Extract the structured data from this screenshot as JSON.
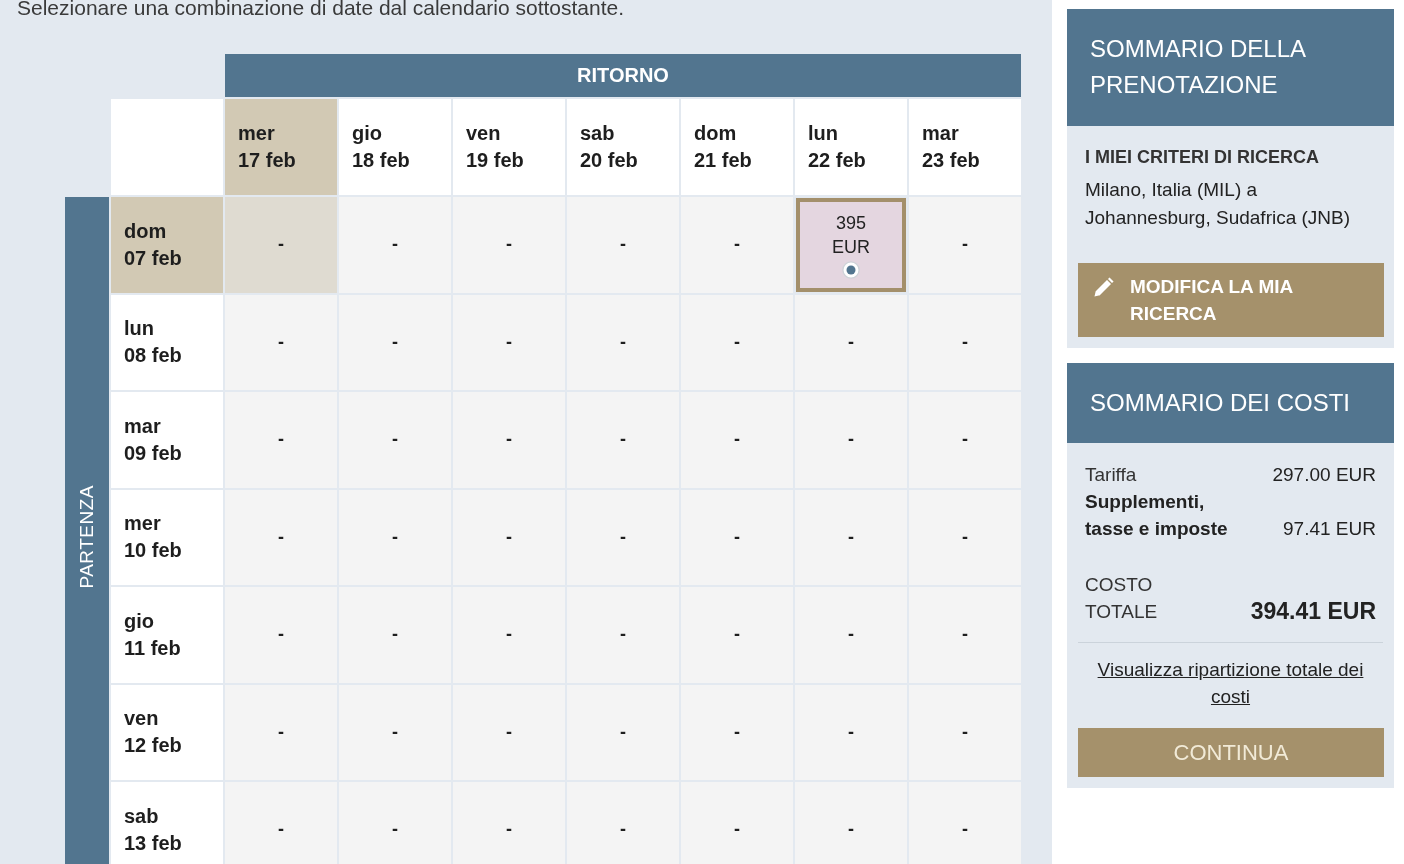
{
  "intro": "Selezionare una combinazione di date dal calendario sottostante.",
  "calendar": {
    "return_label": "RITORNO",
    "departure_label": "PARTENZA",
    "return_dates": [
      {
        "weekday": "mer",
        "date": "17 feb",
        "highlighted": true
      },
      {
        "weekday": "gio",
        "date": "18 feb",
        "highlighted": false
      },
      {
        "weekday": "ven",
        "date": "19 feb",
        "highlighted": false
      },
      {
        "weekday": "sab",
        "date": "20 feb",
        "highlighted": false
      },
      {
        "weekday": "dom",
        "date": "21 feb",
        "highlighted": false
      },
      {
        "weekday": "lun",
        "date": "22 feb",
        "highlighted": false
      },
      {
        "weekday": "mar",
        "date": "23 feb",
        "highlighted": false
      }
    ],
    "departure_rows": [
      {
        "weekday": "dom",
        "date": "07 feb",
        "highlighted": true,
        "cells": [
          {
            "kind": "empty",
            "text": "-"
          },
          {
            "kind": "empty",
            "text": "-"
          },
          {
            "kind": "empty",
            "text": "-"
          },
          {
            "kind": "empty",
            "text": "-"
          },
          {
            "kind": "empty",
            "text": "-"
          },
          {
            "kind": "fare",
            "price": "395 EUR",
            "selected": true
          },
          {
            "kind": "empty",
            "text": "-"
          }
        ]
      },
      {
        "weekday": "lun",
        "date": "08 feb",
        "highlighted": false,
        "cells": [
          {
            "kind": "empty",
            "text": "-"
          },
          {
            "kind": "empty",
            "text": "-"
          },
          {
            "kind": "empty",
            "text": "-"
          },
          {
            "kind": "empty",
            "text": "-"
          },
          {
            "kind": "empty",
            "text": "-"
          },
          {
            "kind": "empty",
            "text": "-"
          },
          {
            "kind": "empty",
            "text": "-"
          }
        ]
      },
      {
        "weekday": "mar",
        "date": "09 feb",
        "highlighted": false,
        "cells": [
          {
            "kind": "empty",
            "text": "-"
          },
          {
            "kind": "empty",
            "text": "-"
          },
          {
            "kind": "empty",
            "text": "-"
          },
          {
            "kind": "empty",
            "text": "-"
          },
          {
            "kind": "empty",
            "text": "-"
          },
          {
            "kind": "empty",
            "text": "-"
          },
          {
            "kind": "empty",
            "text": "-"
          }
        ]
      },
      {
        "weekday": "mer",
        "date": "10 feb",
        "highlighted": false,
        "cells": [
          {
            "kind": "empty",
            "text": "-"
          },
          {
            "kind": "empty",
            "text": "-"
          },
          {
            "kind": "empty",
            "text": "-"
          },
          {
            "kind": "empty",
            "text": "-"
          },
          {
            "kind": "empty",
            "text": "-"
          },
          {
            "kind": "empty",
            "text": "-"
          },
          {
            "kind": "empty",
            "text": "-"
          }
        ]
      },
      {
        "weekday": "gio",
        "date": "11 feb",
        "highlighted": false,
        "cells": [
          {
            "kind": "empty",
            "text": "-"
          },
          {
            "kind": "empty",
            "text": "-"
          },
          {
            "kind": "empty",
            "text": "-"
          },
          {
            "kind": "empty",
            "text": "-"
          },
          {
            "kind": "empty",
            "text": "-"
          },
          {
            "kind": "empty",
            "text": "-"
          },
          {
            "kind": "empty",
            "text": "-"
          }
        ]
      },
      {
        "weekday": "ven",
        "date": "12 feb",
        "highlighted": false,
        "cells": [
          {
            "kind": "empty",
            "text": "-"
          },
          {
            "kind": "empty",
            "text": "-"
          },
          {
            "kind": "empty",
            "text": "-"
          },
          {
            "kind": "empty",
            "text": "-"
          },
          {
            "kind": "empty",
            "text": "-"
          },
          {
            "kind": "empty",
            "text": "-"
          },
          {
            "kind": "empty",
            "text": "-"
          }
        ]
      },
      {
        "weekday": "sab",
        "date": "13 feb",
        "highlighted": false,
        "cells": [
          {
            "kind": "empty",
            "text": "-"
          },
          {
            "kind": "empty",
            "text": "-"
          },
          {
            "kind": "empty",
            "text": "-"
          },
          {
            "kind": "empty",
            "text": "-"
          },
          {
            "kind": "empty",
            "text": "-"
          },
          {
            "kind": "empty",
            "text": "-"
          },
          {
            "kind": "empty",
            "text": "-"
          }
        ]
      }
    ]
  },
  "booking_summary": {
    "title": "SOMMARIO DELLA PRENOTAZIONE",
    "criteria_heading": "I MIEI CRITERI DI RICERCA",
    "route": "Milano, Italia (MIL) a Johannesburg, Sudafrica (JNB)",
    "edit_button": "MODIFICA LA MIA RICERCA"
  },
  "cost_summary": {
    "title": "SOMMARIO DEI COSTI",
    "lines": [
      {
        "kind": "fare",
        "label": "Tariffa",
        "amount": "297.00 EUR"
      },
      {
        "kind": "taxes",
        "label": "Supplementi, tasse e imposte",
        "amount": "97.41 EUR"
      }
    ],
    "total": {
      "label": "COSTO TOTALE",
      "amount": "394.41 EUR"
    },
    "breakdown_link": "Visualizza ripartizione totale dei costi",
    "continue_button": "CONTINUA"
  }
}
